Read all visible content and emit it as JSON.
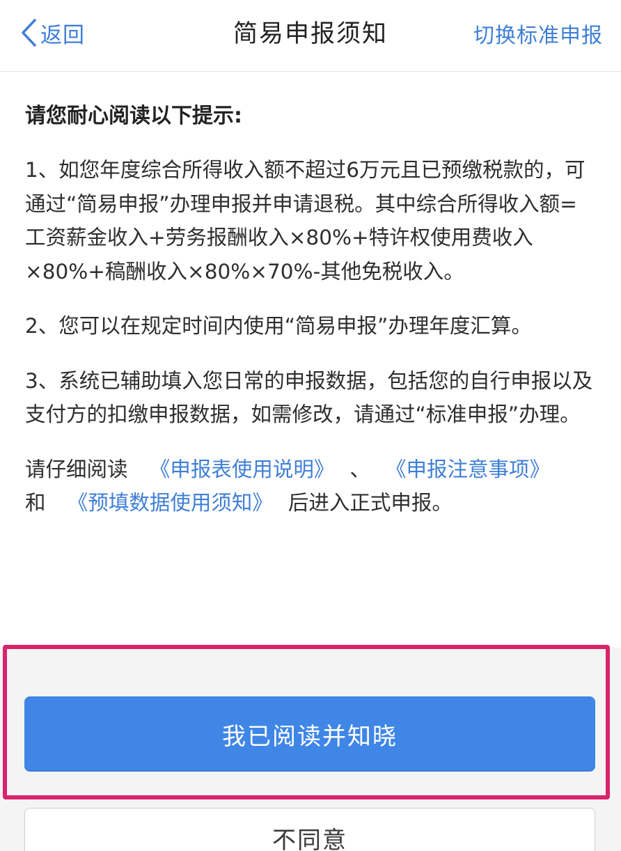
{
  "navbar": {
    "back_label": "返回",
    "title": "简易申报须知",
    "switch_label": "切换标准申报",
    "accent_color": "#3f7fd6"
  },
  "content": {
    "intro": "请您耐心阅读以下提示:",
    "items": [
      "1、如您年度综合所得收入额不超过6万元且已预缴税款的，可通过“简易申报”办理申报并申请退税。其中综合所得收入额=工资薪金收入+劳务报酬收入×80%+特许权使用费收入×80%+稿酬收入×80%×70%-其他免税收入。",
      "2、您可以在规定时间内使用“简易申报”办理年度汇算。",
      "3、系统已辅助填入您日常的申报数据，包括您的自行申报以及支付方的扣缴申报数据，如需修改，请通过“标准申报”办理。"
    ],
    "links_prefix": "请仔细阅读",
    "link_1": "《申报表使用说明》",
    "separator": "、",
    "link_2": "《申报注意事项》",
    "conjunction": "和",
    "link_3": "《预填数据使用须知》",
    "links_suffix": "后进入正式申报。"
  },
  "actions": {
    "confirm_label": "我已阅读并知晓",
    "decline_label": "不同意",
    "confirm_color": "#3f86e6",
    "highlight_color": "#d9236a"
  }
}
